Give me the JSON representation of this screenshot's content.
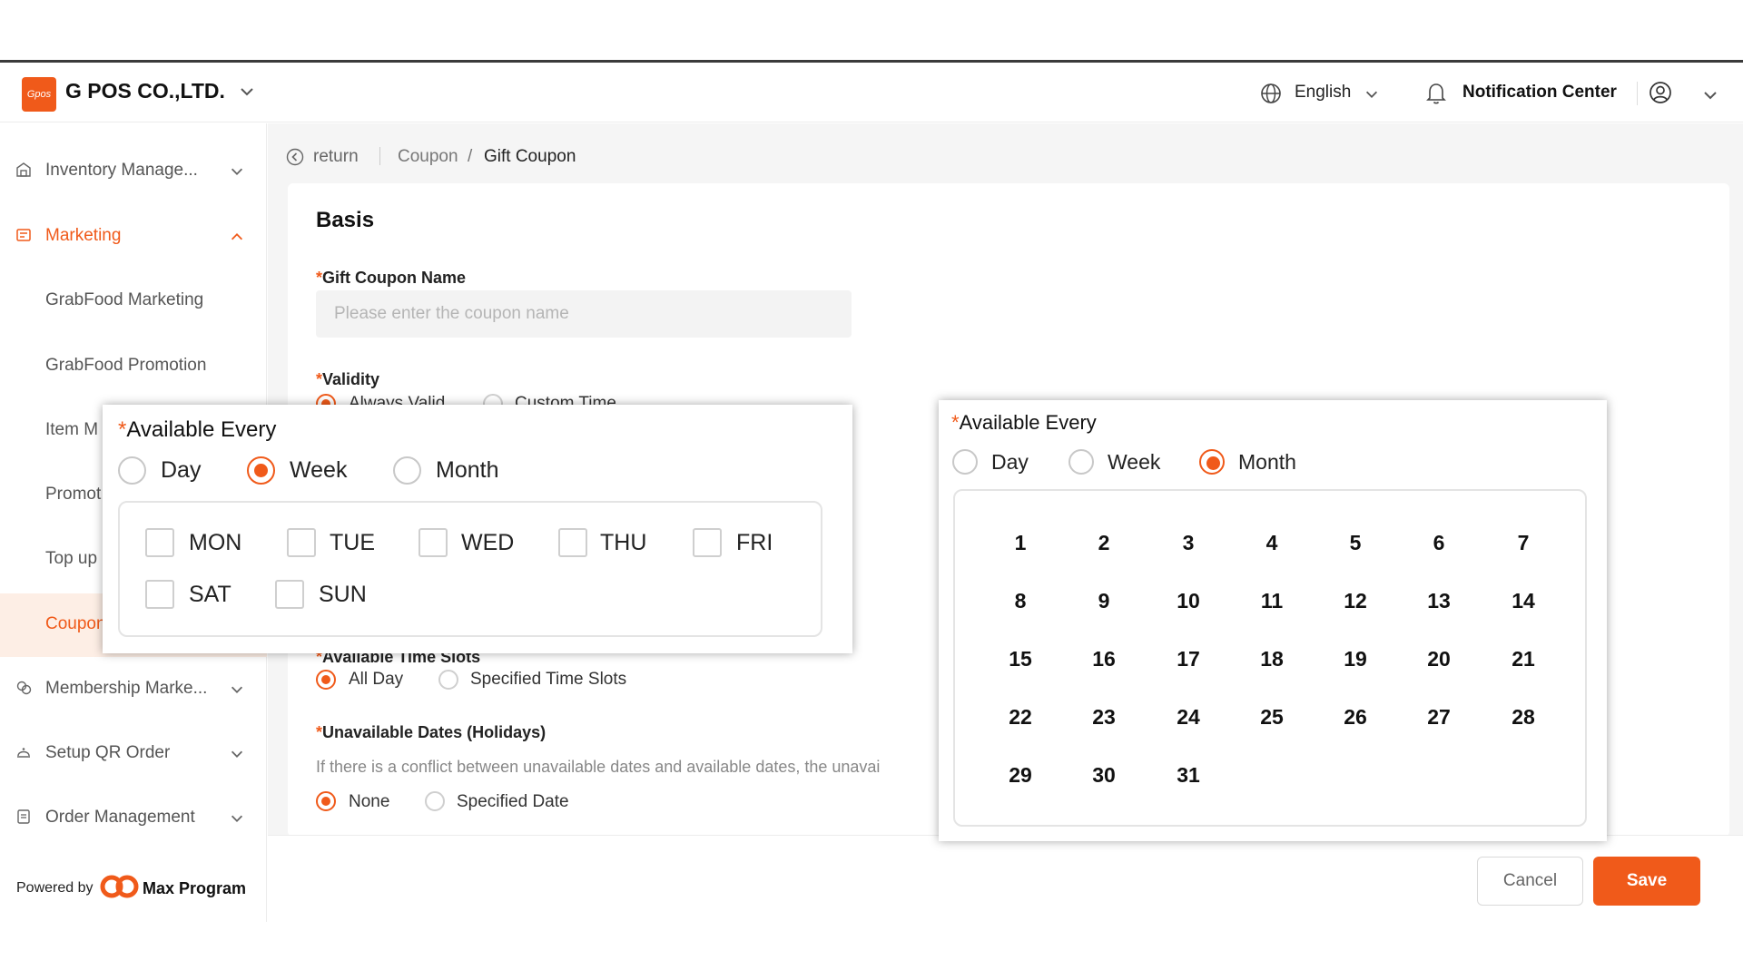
{
  "header": {
    "logo_text": "Gpos",
    "company": "G POS CO.,LTD.",
    "language": "English",
    "notification": "Notification Center"
  },
  "sidebar": {
    "items": [
      {
        "label": "Inventory Manage..."
      },
      {
        "label": "Marketing"
      },
      {
        "label": "GrabFood Marketing"
      },
      {
        "label": "GrabFood Promotion"
      },
      {
        "label": "Item M"
      },
      {
        "label": "Promot"
      },
      {
        "label": "Top up"
      },
      {
        "label": "Coupon"
      },
      {
        "label": "Membership Marke..."
      },
      {
        "label": "Setup QR Order"
      },
      {
        "label": "Order Management"
      }
    ],
    "powered_by": "Powered by",
    "brand": "Max Program"
  },
  "breadcrumb": {
    "return": "return",
    "coupon": "Coupon",
    "separator": "/",
    "current": "Gift Coupon"
  },
  "form": {
    "section_title": "Basis",
    "required_mark": "*",
    "coupon_name_label": "Gift Coupon Name",
    "coupon_name_placeholder": "Please enter the coupon name",
    "validity_label": "Validity",
    "validity_options": [
      "Always Valid",
      "Custom Time"
    ],
    "time_slots_label": "Available Time Slots",
    "time_slots_options": [
      "All Day",
      "Specified Time Slots"
    ],
    "holidays_label": "Unavailable Dates (Holidays)",
    "holidays_hint": "If there is a conflict between unavailable dates and available dates, the unavai",
    "holidays_options": [
      "None",
      "Specified Date"
    ]
  },
  "popup_week": {
    "title": "Available Every",
    "options": [
      "Day",
      "Week",
      "Month"
    ],
    "selected": "Week",
    "weekdays": [
      "MON",
      "TUE",
      "WED",
      "THU",
      "FRI",
      "SAT",
      "SUN"
    ]
  },
  "popup_month": {
    "title": "Available Every",
    "options": [
      "Day",
      "Week",
      "Month"
    ],
    "selected": "Month",
    "days": [
      "1",
      "2",
      "3",
      "4",
      "5",
      "6",
      "7",
      "8",
      "9",
      "10",
      "11",
      "12",
      "13",
      "14",
      "15",
      "16",
      "17",
      "18",
      "19",
      "20",
      "21",
      "22",
      "23",
      "24",
      "25",
      "26",
      "27",
      "28",
      "29",
      "30",
      "31"
    ]
  },
  "footer": {
    "cancel": "Cancel",
    "save": "Save"
  },
  "colors": {
    "accent": "#f05a1a",
    "active_bg": "#fdeee5"
  }
}
